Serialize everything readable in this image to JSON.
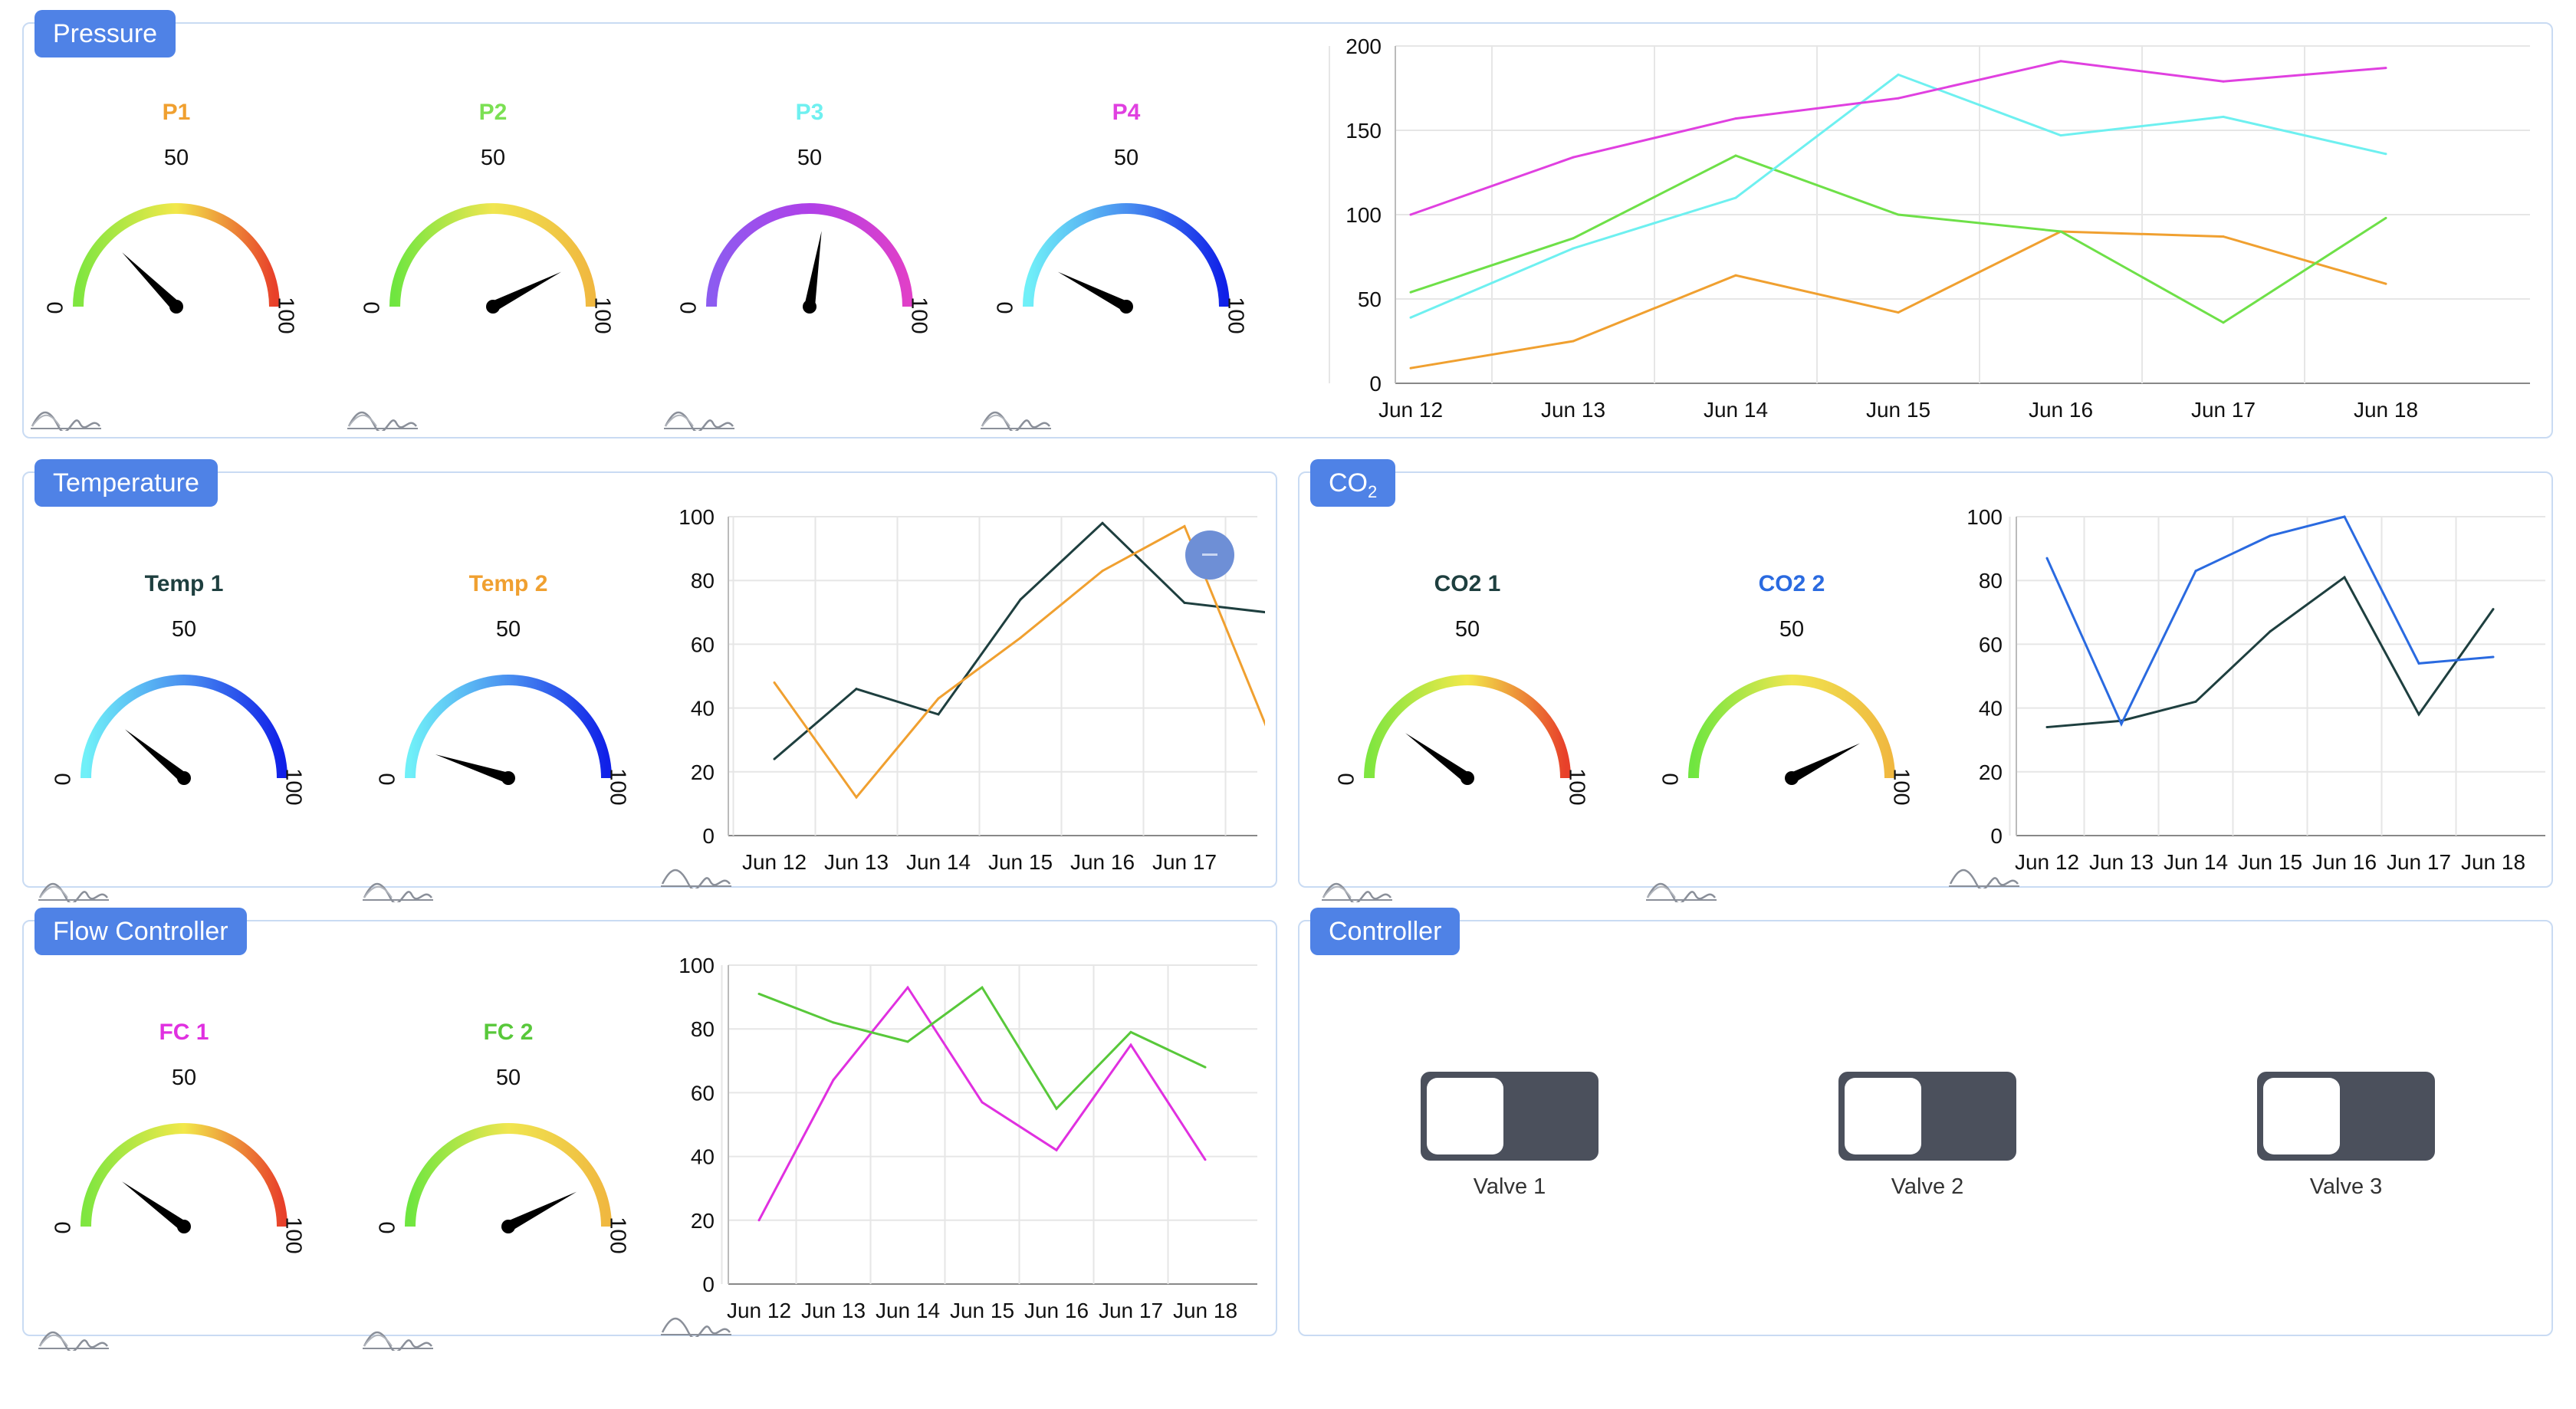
{
  "panels": {
    "pressure": {
      "title": "Pressure"
    },
    "temperature": {
      "title": "Temperature"
    },
    "co2": {
      "title_main": "CO",
      "title_sub": "2"
    },
    "flow": {
      "title": "Flow Controller"
    },
    "controller": {
      "title": "Controller"
    }
  },
  "gauges": {
    "p1": {
      "name": "P1",
      "value": 25,
      "name_color": "#f0a030",
      "min_label": "0",
      "mid_label": "50",
      "max_label": "100",
      "palette": "green-yellow-red"
    },
    "p2": {
      "name": "P2",
      "value": 85,
      "name_color": "#7be053",
      "min_label": "0",
      "mid_label": "50",
      "max_label": "100",
      "palette": "green-yellow"
    },
    "p3": {
      "name": "P3",
      "value": 55,
      "name_color": "#6ff0f0",
      "min_label": "0",
      "mid_label": "50",
      "max_label": "100",
      "palette": "purple-magenta"
    },
    "p4": {
      "name": "P4",
      "value": 15,
      "name_color": "#e040e0",
      "min_label": "0",
      "mid_label": "50",
      "max_label": "100",
      "palette": "cyan-blue"
    },
    "temp1": {
      "name": "Temp 1",
      "value": 22,
      "name_color": "#1e3f3f",
      "min_label": "0",
      "mid_label": "50",
      "max_label": "100",
      "palette": "cyan-blue"
    },
    "temp2": {
      "name": "Temp 2",
      "value": 10,
      "name_color": "#f0a030",
      "min_label": "0",
      "mid_label": "50",
      "max_label": "100",
      "palette": "cyan-blue"
    },
    "co2_1": {
      "name": "CO2 1",
      "value": 20,
      "name_color": "#1e3f3f",
      "min_label": "0",
      "mid_label": "50",
      "max_label": "100",
      "palette": "green-yellow-red"
    },
    "co2_2": {
      "name": "CO2 2",
      "value": 85,
      "name_color": "#2a6ae0",
      "min_label": "0",
      "mid_label": "50",
      "max_label": "100",
      "palette": "green-yellow"
    },
    "fc1": {
      "name": "FC 1",
      "value": 20,
      "name_color": "#e030e0",
      "min_label": "0",
      "mid_label": "50",
      "max_label": "100",
      "palette": "green-yellow-red"
    },
    "fc2": {
      "name": "FC 2",
      "value": 85,
      "name_color": "#58c83a",
      "min_label": "0",
      "mid_label": "50",
      "max_label": "100",
      "palette": "green-yellow"
    }
  },
  "chart_data": [
    {
      "id": "pressure",
      "type": "line",
      "categories": [
        "Jun 12",
        "Jun 13",
        "Jun 14",
        "Jun 15",
        "Jun 16",
        "Jun 17",
        "Jun 18"
      ],
      "ylim": [
        0,
        200
      ],
      "yticks": [
        "0",
        "50",
        "100",
        "150",
        "200"
      ],
      "grid": true,
      "series": [
        {
          "color": "#f0a030",
          "values": [
            9,
            25,
            64,
            42,
            90,
            87,
            59
          ]
        },
        {
          "color": "#6ee048",
          "values": [
            54,
            86,
            135,
            100,
            90,
            36,
            98
          ]
        },
        {
          "color": "#6ef0f0",
          "values": [
            39,
            80,
            110,
            183,
            147,
            158,
            136
          ]
        },
        {
          "color": "#e040e0",
          "values": [
            100,
            134,
            157,
            169,
            191,
            179,
            187
          ]
        }
      ]
    },
    {
      "id": "temperature",
      "type": "line",
      "categories": [
        "Jun 12",
        "Jun 13",
        "Jun 14",
        "Jun 15",
        "Jun 16",
        "Jun 17"
      ],
      "ylim": [
        0,
        100
      ],
      "yticks": [
        "0",
        "20",
        "40",
        "60",
        "80",
        "100"
      ],
      "grid": true,
      "series": [
        {
          "color": "#1e3f3f",
          "values": [
            24,
            46,
            38,
            74,
            98,
            73,
            70
          ]
        },
        {
          "color": "#f0a030",
          "values": [
            48,
            12,
            43,
            62,
            83,
            97,
            34
          ]
        }
      ]
    },
    {
      "id": "co2",
      "type": "line",
      "categories": [
        "Jun 12",
        "Jun 13",
        "Jun 14",
        "Jun 15",
        "Jun 16",
        "Jun 17",
        "Jun 18"
      ],
      "ylim": [
        0,
        100
      ],
      "yticks": [
        "0",
        "20",
        "40",
        "60",
        "80",
        "100"
      ],
      "grid": true,
      "series": [
        {
          "color": "#1e3f3f",
          "values": [
            34,
            36,
            42,
            64,
            81,
            38,
            71
          ]
        },
        {
          "color": "#2a6ae0",
          "values": [
            87,
            35,
            83,
            94,
            100,
            54,
            56
          ]
        }
      ]
    },
    {
      "id": "flow",
      "type": "line",
      "categories": [
        "Jun 12",
        "Jun 13",
        "Jun 14",
        "Jun 15",
        "Jun 16",
        "Jun 17",
        "Jun 18"
      ],
      "ylim": [
        0,
        100
      ],
      "yticks": [
        "0",
        "20",
        "40",
        "60",
        "80",
        "100"
      ],
      "grid": true,
      "series": [
        {
          "color": "#e030e0",
          "values": [
            20,
            64,
            93,
            57,
            42,
            75,
            39
          ]
        },
        {
          "color": "#58c83a",
          "values": [
            91,
            82,
            76,
            93,
            55,
            79,
            68
          ]
        }
      ]
    }
  ],
  "valves": [
    {
      "label": "Valve 1",
      "state": "off"
    },
    {
      "label": "Valve 2",
      "state": "off"
    },
    {
      "label": "Valve 3",
      "state": "off"
    }
  ],
  "icons": {
    "trend": "trend-chart-icon",
    "zoom": "zoom-out-icon"
  }
}
